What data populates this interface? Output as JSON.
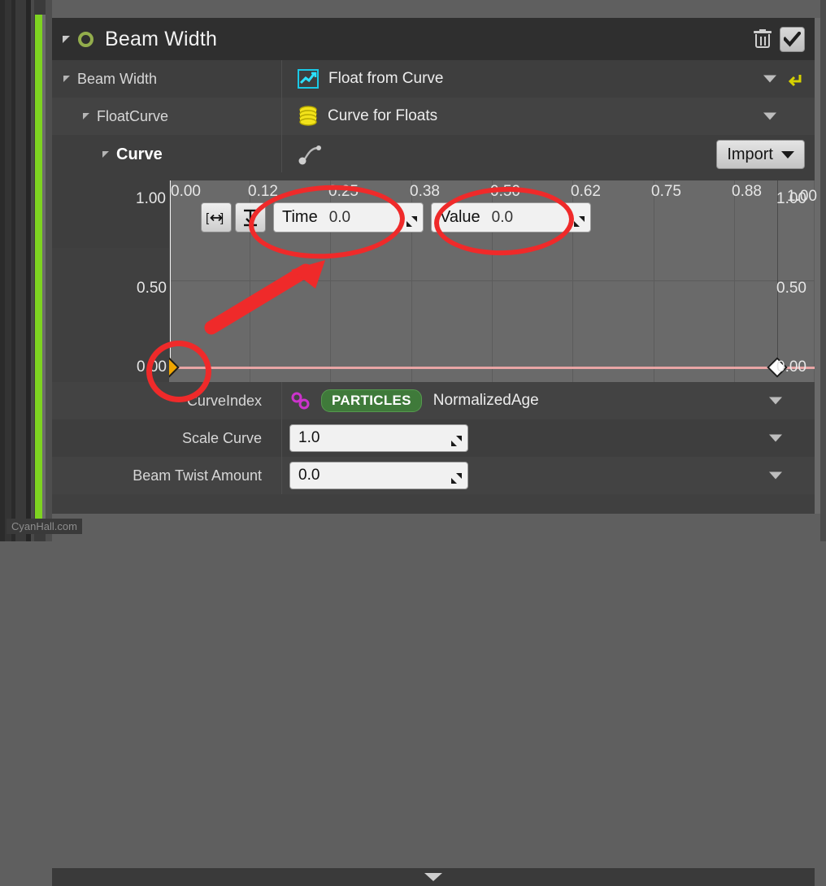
{
  "header": {
    "title": "Beam Width",
    "expander_icon": "triangle-collapse-icon",
    "status_icon": "green-ring-icon",
    "delete_icon": "trash-icon",
    "confirm_icon": "check-icon"
  },
  "rows": [
    {
      "label": "Beam Width",
      "value": "Float from Curve",
      "icon": "line-chart-icon",
      "has_caret": true,
      "has_reset": true
    },
    {
      "label": "FloatCurve",
      "value": "Curve for Floats",
      "icon": "database-stack-icon",
      "has_caret": true,
      "has_reset": false
    },
    {
      "label": "Curve",
      "value": "",
      "icon": "curve-node-icon",
      "has_caret": false,
      "has_reset": false,
      "button": "Import"
    }
  ],
  "graph": {
    "toolbar": {
      "fit_horizontal_icon": "fit-horizontal-icon",
      "fit_vertical_icon": "fit-vertical-icon",
      "time_label": "Time",
      "time_value": "0.0",
      "value_label": "Value",
      "value_value": "0.0"
    },
    "y_top_label": "1.00",
    "y_mid_label": "0.50",
    "y_bottom_label": "0.00",
    "y_top_label_right": "1.00",
    "y_mid_label_right": "0.50",
    "y_bottom_label_right": "0.00",
    "x_ticks": [
      "0.00",
      "0.12",
      "0.25",
      "0.38",
      "0.50",
      "0.62",
      "0.75",
      "0.88",
      "1.00"
    ],
    "keys": [
      {
        "name": "keyframe-selected",
        "time": 0.0,
        "value": 0.0,
        "selected": true
      },
      {
        "name": "keyframe-end",
        "time": 1.0,
        "value": 0.0,
        "selected": false
      }
    ],
    "curve_color": "#e8a5a5"
  },
  "bottom": [
    {
      "label": "CurveIndex",
      "type": "distribution",
      "icon": "link-chain-icon",
      "badge": "PARTICLES",
      "value": "NormalizedAge"
    },
    {
      "label": "Scale Curve",
      "type": "number",
      "value": "1.0"
    },
    {
      "label": "Beam Twist Amount",
      "type": "number",
      "value": "0.0"
    }
  ],
  "footer": {
    "expand_icon": "chevron-down-icon"
  },
  "watermark": "CyanHall.com",
  "annotations": {
    "ellipse_time": "highlight-time-field",
    "ellipse_value": "highlight-value-field",
    "circle_key": "highlight-selected-key",
    "arrow": "pointer-arrow"
  },
  "colors": {
    "accent_green": "#7ed321",
    "annotation_red": "#ef2a2a",
    "key_selected": "#f0a500",
    "badge_green": "#3f7a3a"
  }
}
